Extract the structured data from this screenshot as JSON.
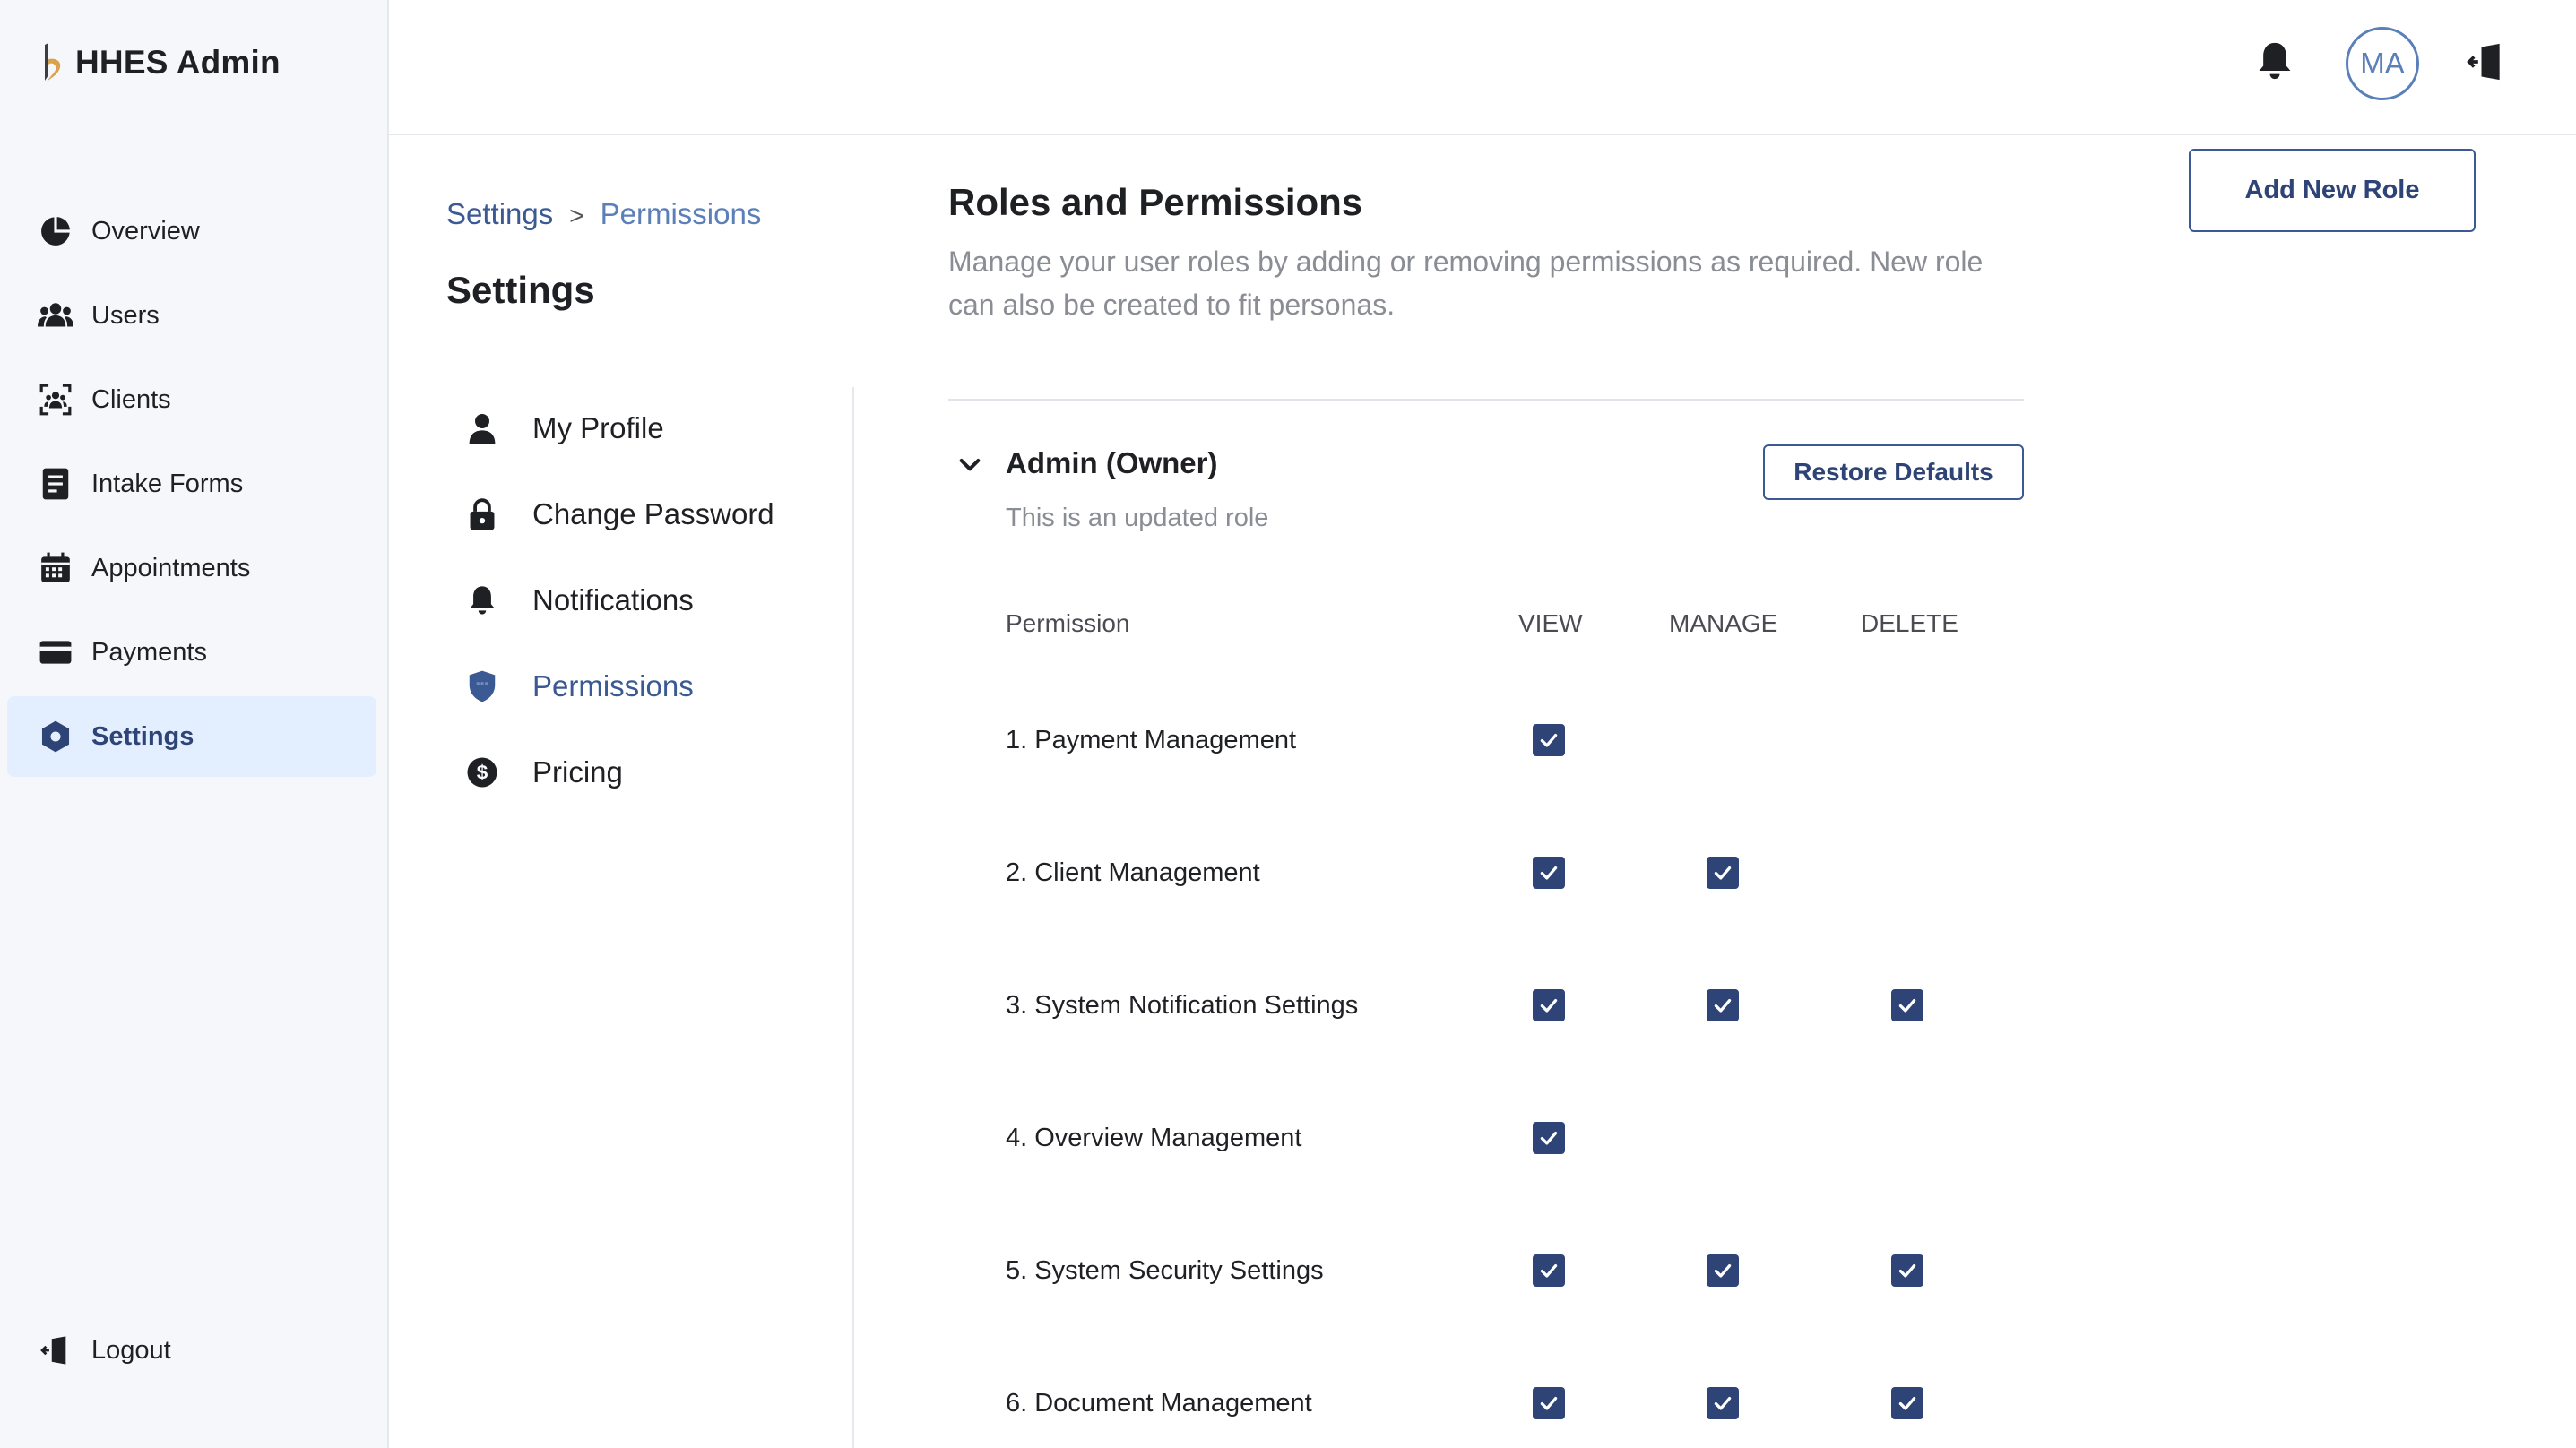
{
  "app": {
    "brand_name": "HHES Admin"
  },
  "sidebar": {
    "items": [
      {
        "label": "Overview",
        "icon": "pie-chart-icon"
      },
      {
        "label": "Users",
        "icon": "users-icon"
      },
      {
        "label": "Clients",
        "icon": "clients-icon"
      },
      {
        "label": "Intake Forms",
        "icon": "form-icon"
      },
      {
        "label": "Appointments",
        "icon": "calendar-icon"
      },
      {
        "label": "Payments",
        "icon": "credit-card-icon"
      },
      {
        "label": "Settings",
        "icon": "settings-icon",
        "active": true
      }
    ],
    "logout_label": "Logout"
  },
  "header": {
    "avatar_initials": "MA"
  },
  "settings": {
    "breadcrumb": {
      "parent": "Settings",
      "separator": ">",
      "current": "Permissions"
    },
    "title": "Settings",
    "menu": [
      {
        "label": "My Profile",
        "icon": "user-icon"
      },
      {
        "label": "Change Password",
        "icon": "lock-icon"
      },
      {
        "label": "Notifications",
        "icon": "bell-icon"
      },
      {
        "label": "Permissions",
        "icon": "shield-icon",
        "active": true
      },
      {
        "label": "Pricing",
        "icon": "dollar-icon"
      }
    ]
  },
  "main": {
    "title": "Roles and Permissions",
    "description": "Manage your user roles by adding or removing permissions as required. New role can also be created to fit personas.",
    "add_role_label": "Add New Role",
    "role": {
      "name": "Admin (Owner)",
      "description": "This is an updated role",
      "restore_label": "Restore Defaults"
    },
    "table": {
      "headers": {
        "permission": "Permission",
        "view": "VIEW",
        "manage": "MANAGE",
        "delete": "DELETE"
      },
      "rows": [
        {
          "name": "1. Payment Management",
          "view": true,
          "manage": false,
          "delete": false
        },
        {
          "name": "2. Client Management",
          "view": true,
          "manage": true,
          "delete": false
        },
        {
          "name": "3. System Notification Settings",
          "view": true,
          "manage": true,
          "delete": true
        },
        {
          "name": "4. Overview Management",
          "view": true,
          "manage": false,
          "delete": false
        },
        {
          "name": "5. System Security Settings",
          "view": true,
          "manage": true,
          "delete": true
        },
        {
          "name": "6. Document Management",
          "view": true,
          "manage": true,
          "delete": true
        }
      ]
    }
  },
  "colors": {
    "accent": "#2e4477",
    "accent_light": "#5b7fb8",
    "active_bg": "#e3efff",
    "sidebar_bg": "#f6f7fb",
    "muted_text": "#8a8d94"
  }
}
